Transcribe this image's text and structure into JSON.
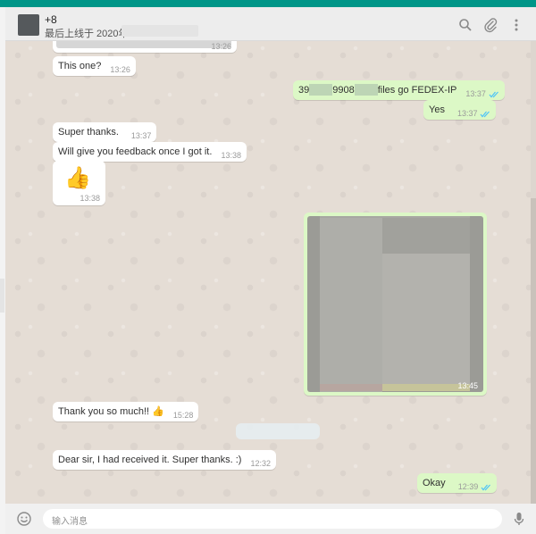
{
  "header": {
    "contact_name": "+8",
    "last_seen": "最后上线于 2020年"
  },
  "messages": [
    {
      "id": "m0",
      "direction": "in",
      "text": "",
      "time": "13:26",
      "note_cut": true
    },
    {
      "id": "m1",
      "direction": "in",
      "text": "This one?",
      "time": "13:26"
    },
    {
      "id": "m2",
      "direction": "out",
      "text_parts": [
        "39",
        "9908 ",
        " files go FEDEX-IP"
      ],
      "time": "13:37",
      "ticks": true
    },
    {
      "id": "m3",
      "direction": "out",
      "text": "Yes",
      "time": "13:37",
      "ticks": true
    },
    {
      "id": "m4",
      "direction": "in",
      "text": "Super thanks.",
      "time": "13:37"
    },
    {
      "id": "m5",
      "direction": "in",
      "text": "Will give you feedback once I got it.",
      "time": "13:38"
    },
    {
      "id": "m6",
      "direction": "in",
      "emoji": "👍",
      "time": "13:38"
    },
    {
      "id": "m7",
      "direction": "out",
      "image": true,
      "time": "13:45",
      "ticks": true
    },
    {
      "id": "m8",
      "direction": "in",
      "text": "Thank you so much!! 👍",
      "time": "15:28"
    },
    {
      "id": "m9",
      "direction": "in",
      "text": "Dear sir, I had received it. Super thanks. :)",
      "time": "12:32"
    },
    {
      "id": "m10",
      "direction": "out",
      "text": "Okay",
      "time": "12:39",
      "ticks": true
    }
  ],
  "composer": {
    "placeholder": "输入消息"
  },
  "icons": {
    "header": [
      "search-icon",
      "paperclip-icon",
      "menu-icon"
    ],
    "composer": [
      "emoji-icon",
      "mic-icon"
    ]
  },
  "colors": {
    "accent": "#009688",
    "chat_background": "#e5ddd5",
    "incoming_bubble": "#ffffff",
    "outgoing_bubble": "#dcf8c6",
    "read_ticks": "#4fc3f7"
  }
}
